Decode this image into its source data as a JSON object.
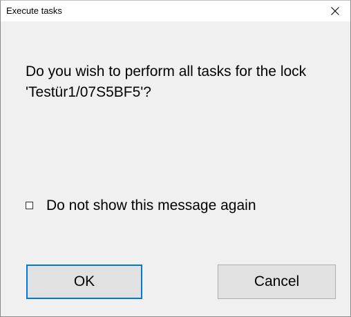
{
  "window": {
    "title": "Execute tasks"
  },
  "message": {
    "text": "Do you wish to perform all tasks for the lock 'Testür1/07S5BF5'?"
  },
  "checkbox": {
    "label": "Do not show this message again",
    "checked": false
  },
  "buttons": {
    "ok_label": "OK",
    "cancel_label": "Cancel"
  },
  "colors": {
    "dialog_background": "#f0f0f0",
    "titlebar_background": "#ffffff",
    "button_face": "#e1e1e1",
    "default_button_border": "#0078d7"
  },
  "icons": {
    "close": "close-icon"
  }
}
